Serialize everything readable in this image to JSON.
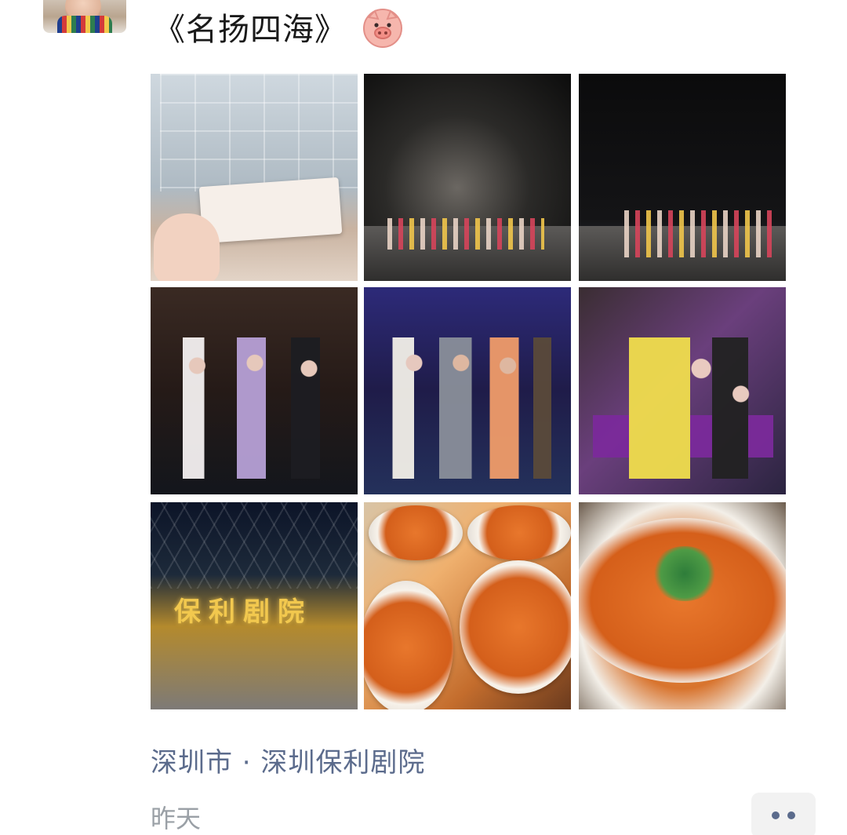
{
  "post": {
    "text": "《名扬四海》",
    "emoji_icon": "pig-face-icon",
    "location": "深圳市 · 深圳保利剧院",
    "time": "昨天",
    "photos": [
      {
        "name": "photo-ticket-building"
      },
      {
        "name": "photo-stage-wide"
      },
      {
        "name": "photo-stage-curtain-call"
      },
      {
        "name": "photo-dancers-1"
      },
      {
        "name": "photo-dancers-2"
      },
      {
        "name": "photo-dancers-3"
      },
      {
        "name": "photo-poly-theatre",
        "sign": "保利剧院"
      },
      {
        "name": "photo-noodle-bowls"
      },
      {
        "name": "photo-noodle-closeup"
      }
    ]
  },
  "icons": {
    "avatar": "avatar",
    "more": "more-options-icon"
  },
  "colors": {
    "link_blue": "#5b6b8c",
    "time_gray": "#9aa0a6",
    "text": "#1a1a1a",
    "button_bg": "#f2f2f2"
  }
}
